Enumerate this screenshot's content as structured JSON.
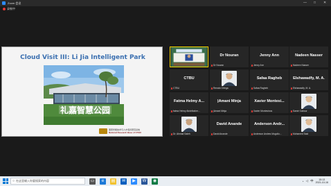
{
  "window": {
    "title": "Zoom 会议",
    "minimize": "—",
    "maximize": "□",
    "close": "✕"
  },
  "recording": {
    "label": "录制中"
  },
  "slide": {
    "title": "Cloud Visit III: Li Jia Intelligent Park",
    "sign_text": "礼嘉智慧公园",
    "footer_cn": "国家智能技术与人才培养研究基地",
    "footer_en": "National Research Base of CTBU"
  },
  "participants": [
    {
      "id": "self-video",
      "name": "",
      "label": "",
      "active": true,
      "muted": false,
      "video": "screen"
    },
    {
      "id": "dr-nouran",
      "name": "Dr Nouran",
      "label": "Dr Nouran",
      "muted": true
    },
    {
      "id": "jenny-ann",
      "name": "Jenny Ann",
      "label": "Jenny Ann",
      "muted": true
    },
    {
      "id": "nadeen-nasser",
      "name": "Nadeen Nasser",
      "label": "Nadeen Nasser",
      "muted": true
    },
    {
      "id": "ctbu",
      "name": "CTBU",
      "label": "CTBU",
      "muted": true
    },
    {
      "id": "renato-ortega",
      "name": "",
      "label": "Renato Ortega",
      "muted": true,
      "video": "person"
    },
    {
      "id": "safaa-ragheb",
      "name": "Safaa Ragheb",
      "label": "Safaa Ragheb",
      "muted": true
    },
    {
      "id": "elshawadfy",
      "name": "Elshawadfy, M. A.",
      "label": "Elshawadfy, M. A.",
      "muted": true
    },
    {
      "id": "fatma-helmy",
      "name": "Fatma Helmy A...",
      "label": "fatma Helmy Abdelbaher...",
      "muted": true
    },
    {
      "id": "amani-minja",
      "name": "|Amani Minja",
      "label": "|Amani Minja",
      "muted": true
    },
    {
      "id": "xavier-montesi",
      "name": "Xavier Montesi...",
      "label": "Xavier Montesinos",
      "muted": true
    },
    {
      "id": "samir-gabour",
      "name": "",
      "label": "Samir Gabour",
      "muted": true,
      "video": "person"
    },
    {
      "id": "ahmad-saleh",
      "name": "",
      "label": "Dr. Ahmad Saleh",
      "muted": true,
      "video": "person"
    },
    {
      "id": "david-anande",
      "name": "David Anande",
      "label": "David Anande",
      "muted": true
    },
    {
      "id": "anderson-andre",
      "name": "Anderson Andr...",
      "label": "Anderson Andres Mogollo...",
      "muted": true
    },
    {
      "id": "mohamed-said",
      "name": "",
      "label": "Mohamed Said",
      "muted": true,
      "video": "person"
    }
  ],
  "taskbar": {
    "search_placeholder": "在这里输入你要搜索的内容",
    "time": "15:13",
    "date": "2021-10-16",
    "lang": "中"
  },
  "colors": {
    "accent": "#2d8cff",
    "active_border": "#f5d000",
    "mute": "#e53935"
  }
}
